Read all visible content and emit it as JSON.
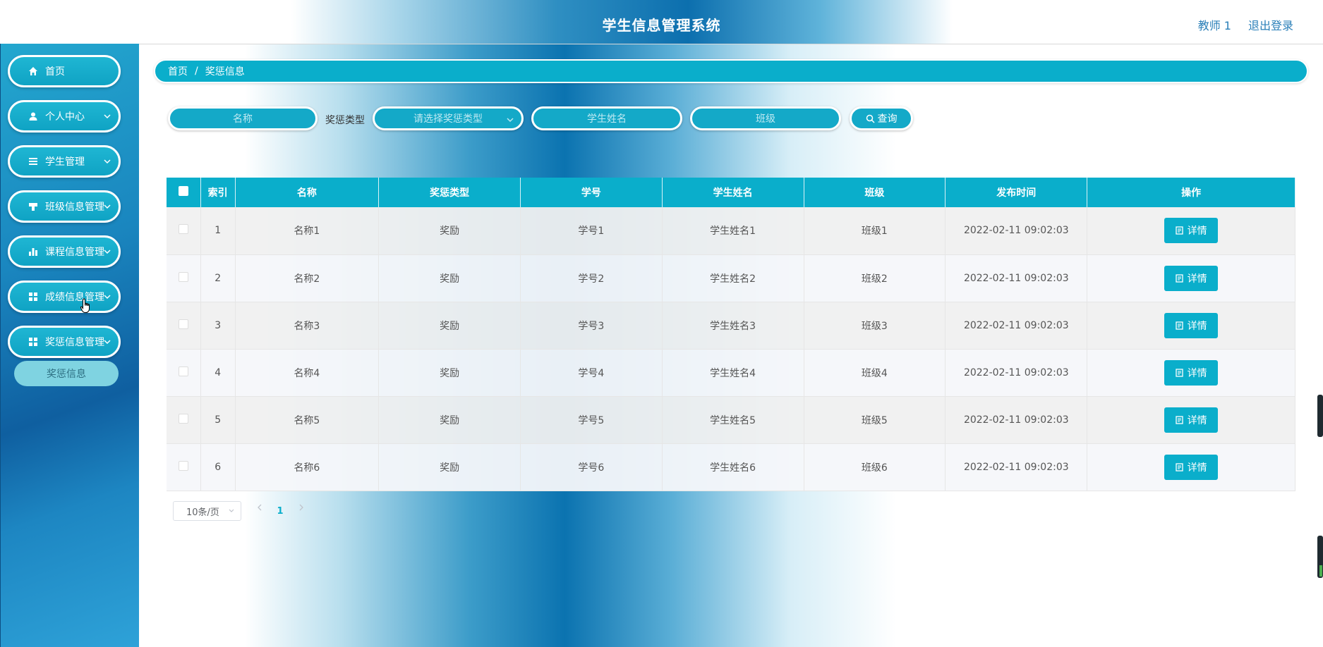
{
  "header": {
    "title": "学生信息管理系统",
    "user": "教师 1",
    "logout": "退出登录"
  },
  "sidebar": {
    "items": [
      {
        "label": "首页",
        "icon": "home-icon"
      },
      {
        "label": "个人中心",
        "icon": "user-icon"
      },
      {
        "label": "学生管理",
        "icon": "list-icon"
      },
      {
        "label": "班级信息管理",
        "icon": "class-icon"
      },
      {
        "label": "课程信息管理",
        "icon": "bar-chart-icon"
      },
      {
        "label": "成绩信息管理",
        "icon": "grid-icon"
      },
      {
        "label": "奖惩信息管理",
        "icon": "grid-icon"
      }
    ],
    "sub_item": "奖惩信息"
  },
  "breadcrumb": {
    "home": "首页",
    "separator": "/",
    "current": "奖惩信息"
  },
  "search": {
    "name_placeholder": "名称",
    "type_label": "奖惩类型",
    "type_placeholder": "请选择奖惩类型",
    "student_placeholder": "学生姓名",
    "class_placeholder": "班级",
    "query_button": "查询"
  },
  "table": {
    "columns": [
      "索引",
      "名称",
      "奖惩类型",
      "学号",
      "学生姓名",
      "班级",
      "发布时间",
      "操作"
    ],
    "rows": [
      {
        "index": "1",
        "name": "名称1",
        "type": "奖励",
        "sid": "学号1",
        "student": "学生姓名1",
        "class": "班级1",
        "time": "2022-02-11 09:02:03",
        "action": "详情"
      },
      {
        "index": "2",
        "name": "名称2",
        "type": "奖励",
        "sid": "学号2",
        "student": "学生姓名2",
        "class": "班级2",
        "time": "2022-02-11 09:02:03",
        "action": "详情"
      },
      {
        "index": "3",
        "name": "名称3",
        "type": "奖励",
        "sid": "学号3",
        "student": "学生姓名3",
        "class": "班级3",
        "time": "2022-02-11 09:02:03",
        "action": "详情"
      },
      {
        "index": "4",
        "name": "名称4",
        "type": "奖励",
        "sid": "学号4",
        "student": "学生姓名4",
        "class": "班级4",
        "time": "2022-02-11 09:02:03",
        "action": "详情"
      },
      {
        "index": "5",
        "name": "名称5",
        "type": "奖励",
        "sid": "学号5",
        "student": "学生姓名5",
        "class": "班级5",
        "time": "2022-02-11 09:02:03",
        "action": "详情"
      },
      {
        "index": "6",
        "name": "名称6",
        "type": "奖励",
        "sid": "学号6",
        "student": "学生姓名6",
        "class": "班级6",
        "time": "2022-02-11 09:02:03",
        "action": "详情"
      }
    ]
  },
  "pagination": {
    "page_size": "10条/页",
    "current_page": "1"
  },
  "colors": {
    "accent": "#0aaecb",
    "sidebar": "#1a86bf",
    "text": "#555555"
  }
}
